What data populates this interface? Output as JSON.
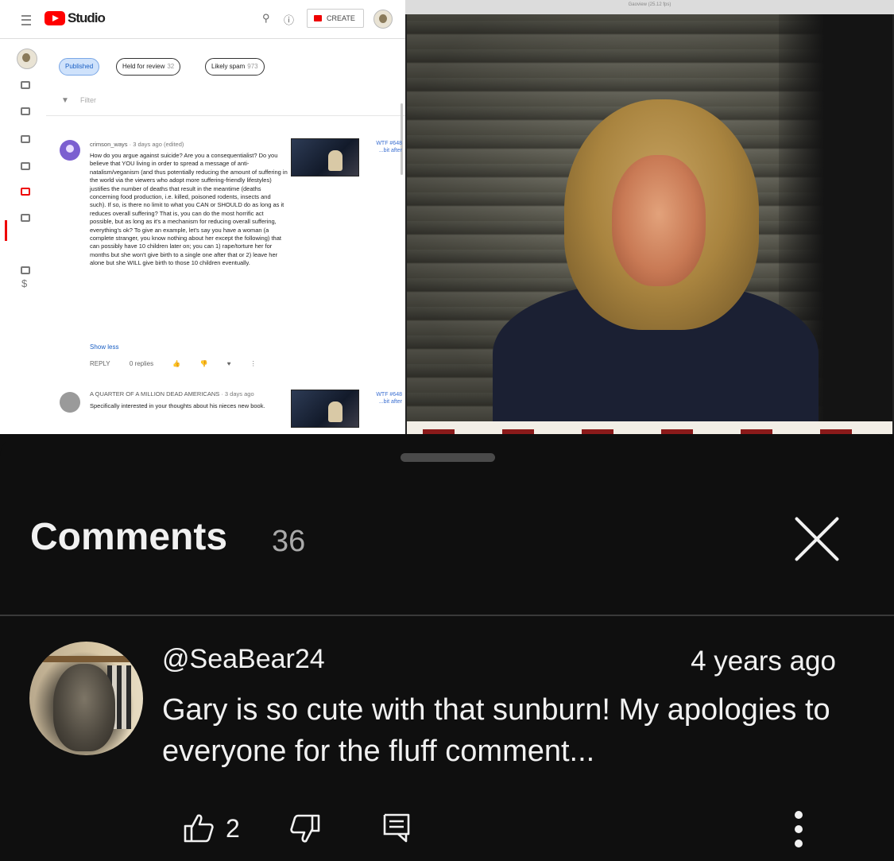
{
  "studio": {
    "brand": "Studio",
    "create_label": "CREATE",
    "chips": [
      {
        "label": "Published",
        "count": ""
      },
      {
        "label": "Held for review",
        "count": "32"
      },
      {
        "label": "Likely spam",
        "count": "973"
      }
    ],
    "filter_placeholder": "Filter",
    "comments": [
      {
        "author": "crimson_ways",
        "meta": "· 3 days ago (edited)",
        "text": "How do you argue against suicide? Are you a consequentialist? Do you believe that YOU living in order to spread a message of anti-natalism/veganism (and thus potentially reducing the amount of suffering in the world via the viewers who adopt more suffering-friendly lifestyles) justifies the number of deaths that result in the meantime (deaths concerning food production, i.e. killed, poisoned rodents, insects and such). If so, is there no limit to what you CAN or SHOULD do as long as it reduces overall suffering? That is, you can do the most horrific act possible, but as long as it's a mechanism for reducing overall suffering, everything's ok? To give an example, let's say you have a woman (a complete stranger, you know nothing about her except the following) that can possibly have 10 children later on; you can 1) rape/torture her for months but she won't give birth to a single one after that or 2) leave her alone but she WILL give birth to those 10 children eventually.",
        "show_less": "Show less",
        "reply_label": "REPLY",
        "replies_label": "0 replies",
        "video_title": "WTF #648 ...bit after"
      },
      {
        "author": "A QUARTER OF A MILLION DEAD AMERICANS",
        "meta": "· 3 days ago",
        "text": "Specifically interested in your thoughts about his nieces new book.",
        "video_title": "WTF #648 ...bit after"
      }
    ]
  },
  "webcam": {
    "window_title": "Gaoview (25.12 fps)"
  },
  "comments_sheet": {
    "title": "Comments",
    "count": "36",
    "comment": {
      "handle": "@SeaBear24",
      "time": "4 years ago",
      "text": "Gary is so cute with that sunburn! My apologies to everyone for the fluff comment...",
      "likes": "2"
    }
  },
  "colors": {
    "sheet_background": "#0f0f0f",
    "text": "#f1f1f1",
    "muted": "#aaaaaa",
    "studio_accent": "#ff0000"
  },
  "icons": [
    "menu-icon",
    "search-icon",
    "help-icon",
    "camera-icon",
    "filter-icon",
    "close-icon",
    "thumbs-up-icon",
    "thumbs-down-icon",
    "reply-icon",
    "more-vert-icon"
  ]
}
